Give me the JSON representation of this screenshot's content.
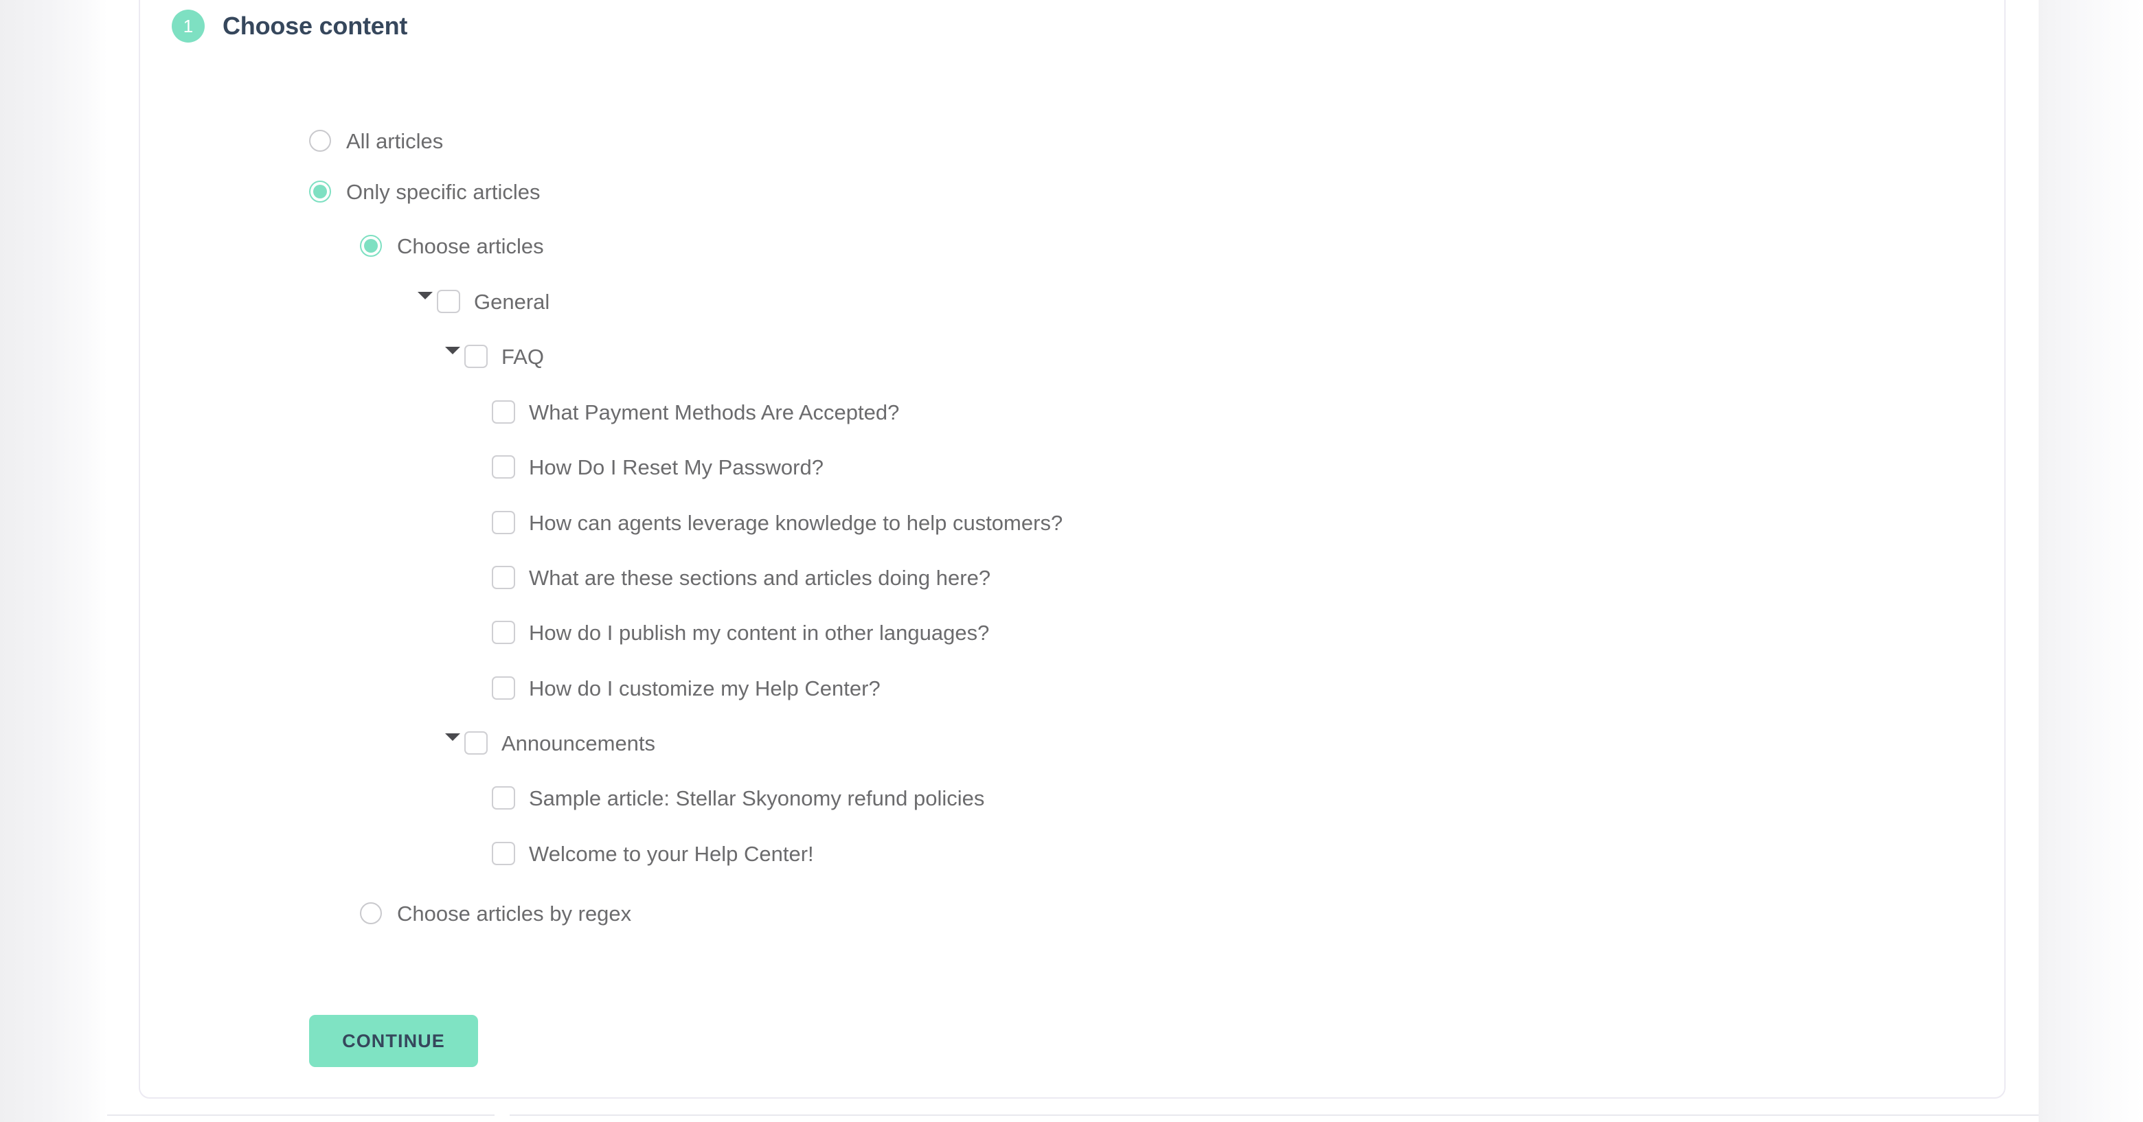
{
  "card": {
    "step_number": "1",
    "title": "Choose content"
  },
  "options": {
    "all_articles": "All articles",
    "only_specific": "Only specific articles",
    "choose_articles": "Choose articles",
    "choose_by_regex": "Choose articles by regex"
  },
  "tree": {
    "general": "General",
    "faq": "FAQ",
    "announcements": "Announcements",
    "faq_articles": [
      "What Payment Methods Are Accepted?",
      "How Do I Reset My Password?",
      "How can agents leverage knowledge to help customers?",
      "What are these sections and articles doing here?",
      "How do I publish my content in other languages?",
      "How do I customize my Help Center?"
    ],
    "announcement_articles": [
      "Sample article: Stellar Skyonomy refund policies",
      "Welcome to your Help Center!"
    ]
  },
  "actions": {
    "continue_label": "CONTINUE"
  },
  "colors": {
    "accent_green": "#7ee0c2",
    "button_green": "#7fe3c3",
    "heading_navy": "#36475c",
    "label_gray": "#6b6b6d",
    "checkbox_border": "#cfcfd3",
    "card_border": "#eceaf2"
  }
}
